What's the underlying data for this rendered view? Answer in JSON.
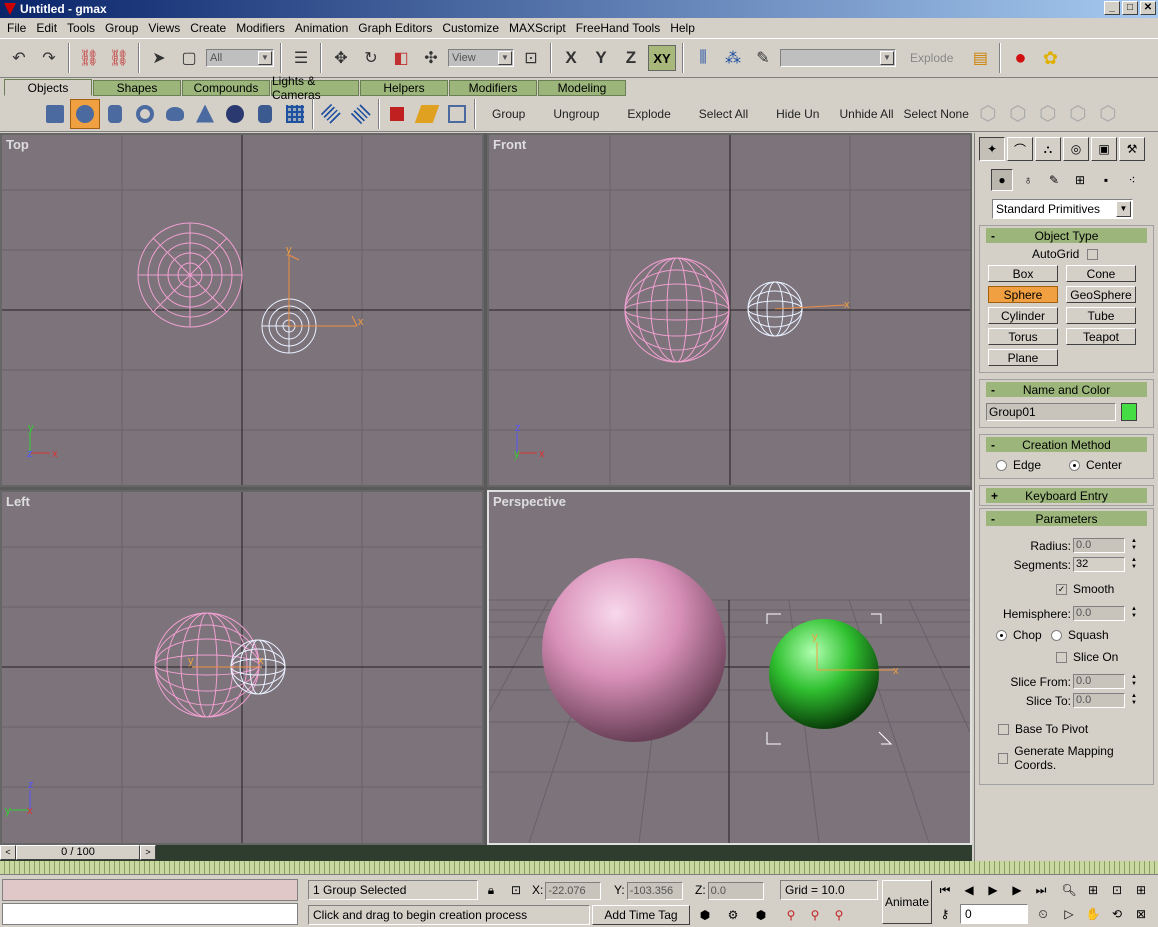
{
  "window": {
    "title": "Untitled - gmax",
    "min": "_",
    "max": "□",
    "close": "✕"
  },
  "menu": [
    "File",
    "Edit",
    "Tools",
    "Group",
    "Views",
    "Create",
    "Modifiers",
    "Animation",
    "Graph Editors",
    "Customize",
    "MAXScript",
    "FreeHand Tools",
    "Help"
  ],
  "toolbar": {
    "selection_filter": "All",
    "ref_coord": "View",
    "axis_x": "X",
    "axis_y": "Y",
    "axis_z": "Z",
    "axis_xy": "XY",
    "named_sel": "",
    "explode": "Explode"
  },
  "tabs": [
    "Objects",
    "Shapes",
    "Compounds",
    "Lights & Cameras",
    "Helpers",
    "Modifiers",
    "Modeling"
  ],
  "objbar": {
    "group": "Group",
    "ungroup": "Ungroup",
    "explode": "Explode",
    "select_all": "Select All",
    "hide_un": "Hide Un",
    "unhide_all": "Unhide All",
    "select_none": "Select None"
  },
  "viewports": {
    "top": "Top",
    "front": "Front",
    "left": "Left",
    "perspective": "Perspective"
  },
  "axis_labels": {
    "x": "x",
    "y": "y",
    "z": "z"
  },
  "panel": {
    "category": "Standard Primitives",
    "object_type": {
      "title": "Object Type",
      "autogrid": "AutoGrid",
      "buttons": [
        "Box",
        "Cone",
        "Sphere",
        "GeoSphere",
        "Cylinder",
        "Tube",
        "Torus",
        "Teapot",
        "Plane"
      ],
      "active": "Sphere"
    },
    "name_color": {
      "title": "Name and Color",
      "name": "Group01",
      "color": "#44dd44"
    },
    "creation": {
      "title": "Creation Method",
      "edge": "Edge",
      "center": "Center"
    },
    "keyboard": {
      "title": "Keyboard Entry",
      "sign": "+"
    },
    "params": {
      "title": "Parameters",
      "radius_label": "Radius:",
      "radius": "0.0",
      "segments_label": "Segments:",
      "segments": "32",
      "smooth": "Smooth",
      "hemisphere_label": "Hemisphere:",
      "hemisphere": "0.0",
      "chop": "Chop",
      "squash": "Squash",
      "slice_on": "Slice On",
      "slice_from_label": "Slice From:",
      "slice_from": "0.0",
      "slice_to_label": "Slice To:",
      "slice_to": "0.0",
      "base_to_pivot": "Base To Pivot",
      "gen_mapping": "Generate Mapping Coords."
    },
    "minus": "-"
  },
  "timeslider": {
    "frame": "0 / 100",
    "prev": "<",
    "next": ">"
  },
  "status": {
    "selected": "1 Group Selected",
    "prompt": "Click and drag to begin creation process",
    "x_label": "X:",
    "x": "-22.076",
    "y_label": "Y:",
    "y": "-103.356",
    "z_label": "Z:",
    "z": "0.0",
    "grid": "Grid = 10.0",
    "add_time_tag": "Add Time Tag",
    "animate": "Animate",
    "frame_field": "0"
  }
}
